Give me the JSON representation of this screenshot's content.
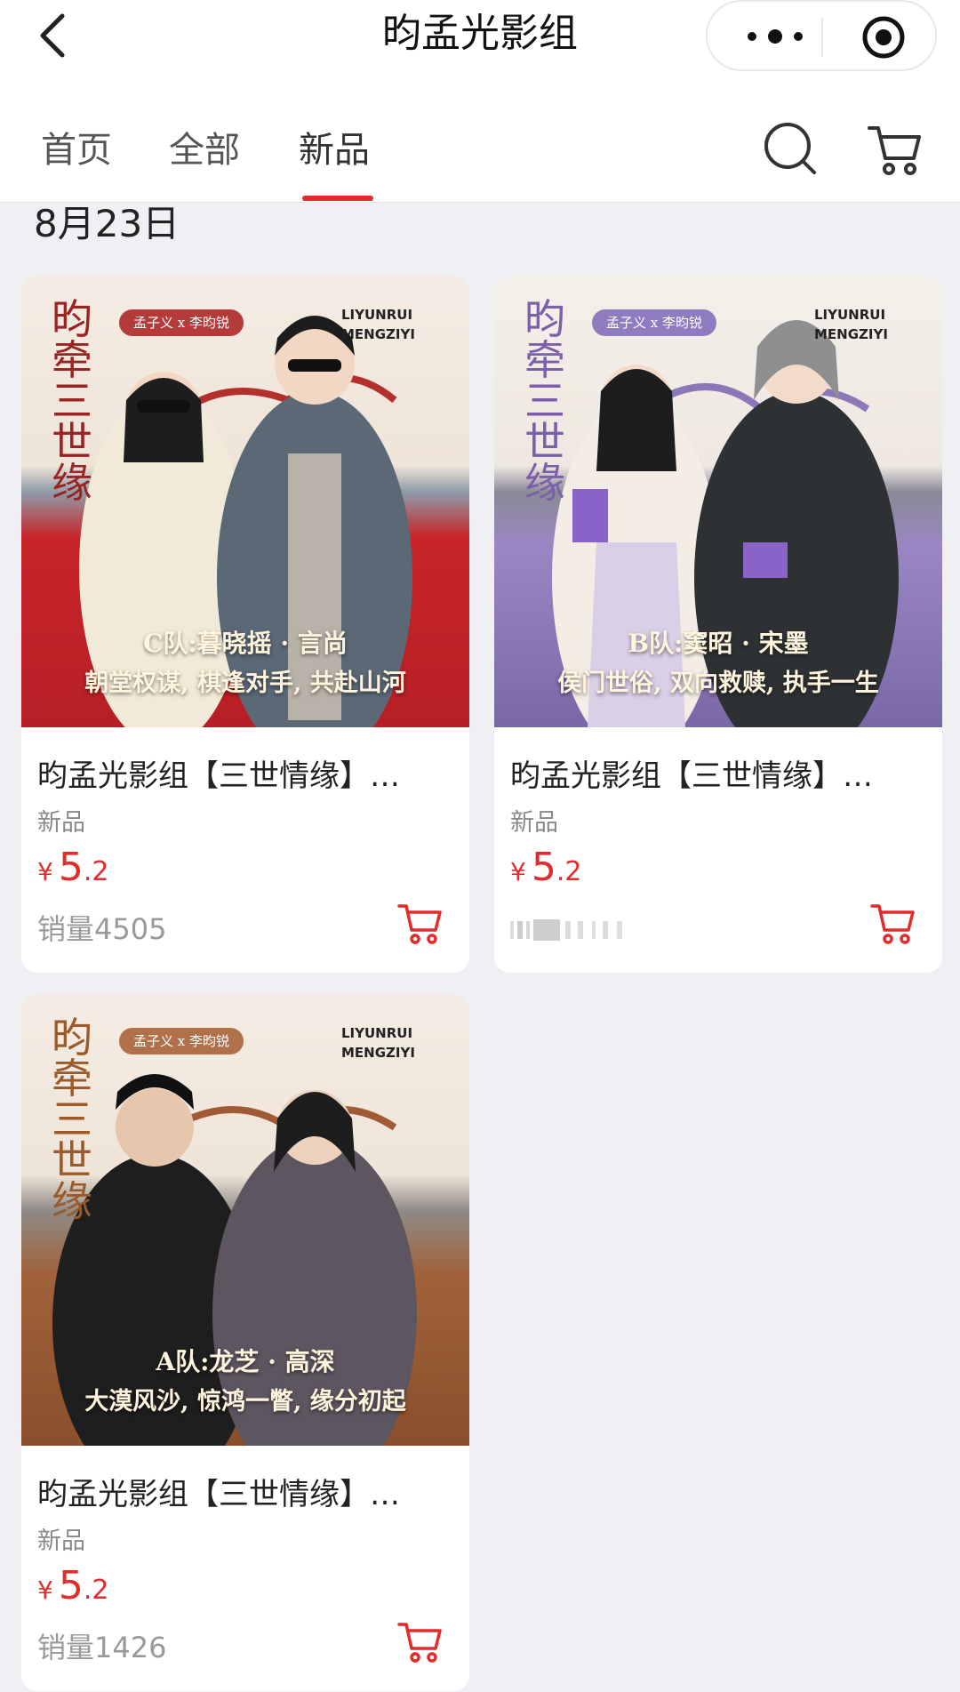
{
  "header": {
    "title": "昀孟光影组"
  },
  "tabs": [
    {
      "label": "首页"
    },
    {
      "label": "全部"
    },
    {
      "label": "新品"
    }
  ],
  "date_label": "8月23日",
  "products": [
    {
      "name": "昀孟光影组【三世情缘】…",
      "tag": "新品",
      "currency": "¥",
      "price_int": "5",
      "price_dec": ".2",
      "sales": "销量4505",
      "poster": {
        "vertical_title": "昀牵三世缘",
        "collab": "孟子义 x 李昀锐",
        "latin_1": "LIYUNRUI",
        "latin_2": "MENGZIYI",
        "caption_1": "C队:暮晓摇 · 言尚",
        "caption_2": "朝堂权谋, 棋逢对手, 共赴山河"
      }
    },
    {
      "name": "昀孟光影组【三世情缘】…",
      "tag": "新品",
      "currency": "¥",
      "price_int": "5",
      "price_dec": ".2",
      "sales": "",
      "poster": {
        "vertical_title": "昀牵三世缘",
        "collab": "孟子义 x 李昀锐",
        "latin_1": "LIYUNRUI",
        "latin_2": "MENGZIYI",
        "caption_1": "B队:窦昭 · 宋墨",
        "caption_2": "侯门世俗, 双向救赎, 执手一生"
      }
    },
    {
      "name": "昀孟光影组【三世情缘】…",
      "tag": "新品",
      "currency": "¥",
      "price_int": "5",
      "price_dec": ".2",
      "sales": "销量1426",
      "poster": {
        "vertical_title": "昀牵三世缘",
        "collab": "孟子义 x 李昀锐",
        "latin_1": "LIYUNRUI",
        "latin_2": "MENGZIYI",
        "caption_1": "A队:龙芝 · 高深",
        "caption_2": "大漠风沙, 惊鸿一瞥, 缘分初起"
      }
    }
  ],
  "colors": {
    "accent": "#e02c2c",
    "page_bg": "#f0f0f4",
    "card1_theme": "#c8242a",
    "card2_theme": "#8a76b8",
    "card3_theme": "#a0623a"
  },
  "icons": [
    "back-arrow-icon",
    "more-dots-icon",
    "target-icon",
    "search-icon",
    "cart-icon"
  ]
}
